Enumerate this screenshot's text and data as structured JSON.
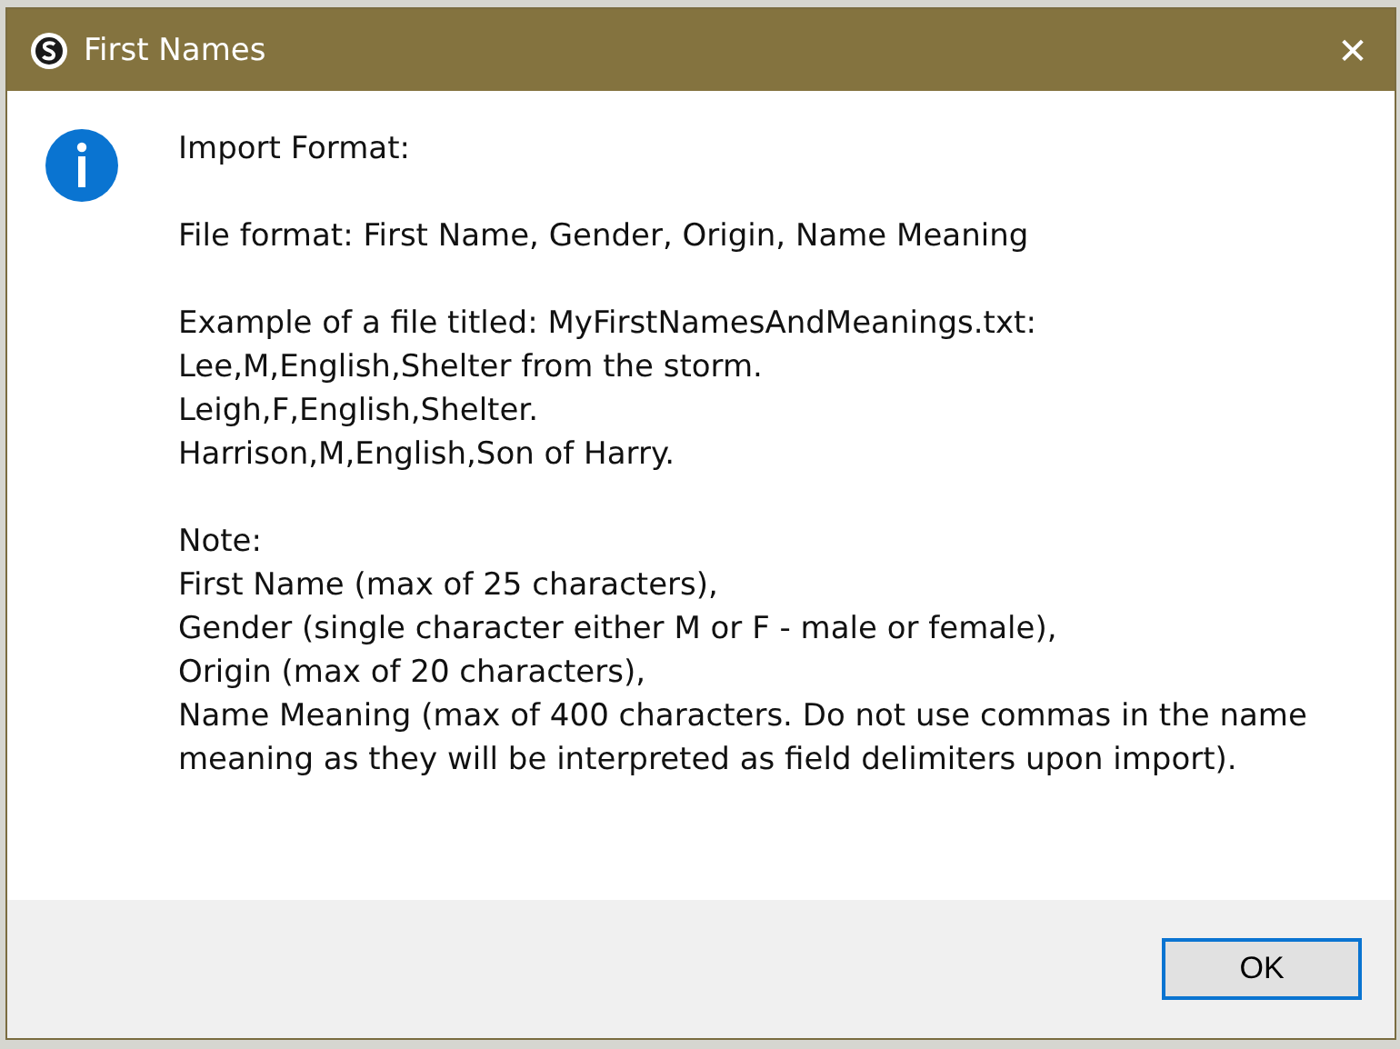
{
  "window": {
    "title": "First Names",
    "close": "✕"
  },
  "message": {
    "heading": "Import Format:",
    "blocks": [
      [
        "File format:  First Name, Gender, Origin, Name Meaning"
      ],
      [
        "Example of a file titled: MyFirstNamesAndMeanings.txt:",
        "Lee,M,English,Shelter from the storm.",
        "Leigh,F,English,Shelter.",
        "Harrison,M,English,Son of Harry."
      ],
      [
        "Note:",
        "First Name (max of 25 characters),",
        "Gender (single character either M or F - male or female),",
        "Origin (max of 20 characters),",
        "Name Meaning (max of 400 characters. Do not use commas in the name meaning as they will be interpreted as field delimiters upon import)."
      ]
    ]
  },
  "buttons": [
    "OK"
  ]
}
